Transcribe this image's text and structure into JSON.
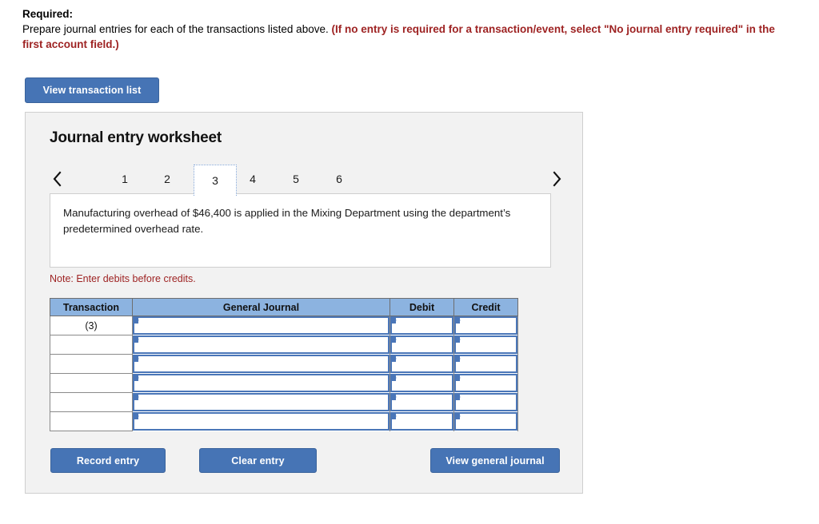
{
  "required": {
    "label": "Required:",
    "instruction": "Prepare journal entries for each of the transactions listed above.",
    "emphasis": "(If no entry is required for a transaction/event, select \"No journal entry required\" in the first account field.)"
  },
  "buttons": {
    "view_transaction_list": "View transaction list",
    "record_entry": "Record entry",
    "clear_entry": "Clear entry",
    "view_general_journal": "View general journal"
  },
  "worksheet": {
    "title": "Journal entry worksheet",
    "tabs": [
      "1",
      "2",
      "3",
      "4",
      "5",
      "6"
    ],
    "selected_tab": "3",
    "prev_icon": "chevron-left-icon",
    "next_icon": "chevron-right-icon",
    "description": "Manufacturing overhead of $46,400 is applied in the Mixing Department using the department’s predetermined overhead rate.",
    "note": "Note: Enter debits before credits."
  },
  "table": {
    "columns": [
      "Transaction",
      "General Journal",
      "Debit",
      "Credit"
    ],
    "rows": [
      {
        "transaction": "(3)",
        "general_journal": "",
        "debit": "",
        "credit": ""
      },
      {
        "transaction": "",
        "general_journal": "",
        "debit": "",
        "credit": ""
      },
      {
        "transaction": "",
        "general_journal": "",
        "debit": "",
        "credit": ""
      },
      {
        "transaction": "",
        "general_journal": "",
        "debit": "",
        "credit": ""
      },
      {
        "transaction": "",
        "general_journal": "",
        "debit": "",
        "credit": ""
      },
      {
        "transaction": "",
        "general_journal": "",
        "debit": "",
        "credit": ""
      }
    ]
  },
  "colors": {
    "button_blue": "#4674b5",
    "header_blue": "#8cb3e0",
    "field_blue": "#4a76b8",
    "alert_red": "#9e2323",
    "panel_gray": "#f2f2f2"
  }
}
